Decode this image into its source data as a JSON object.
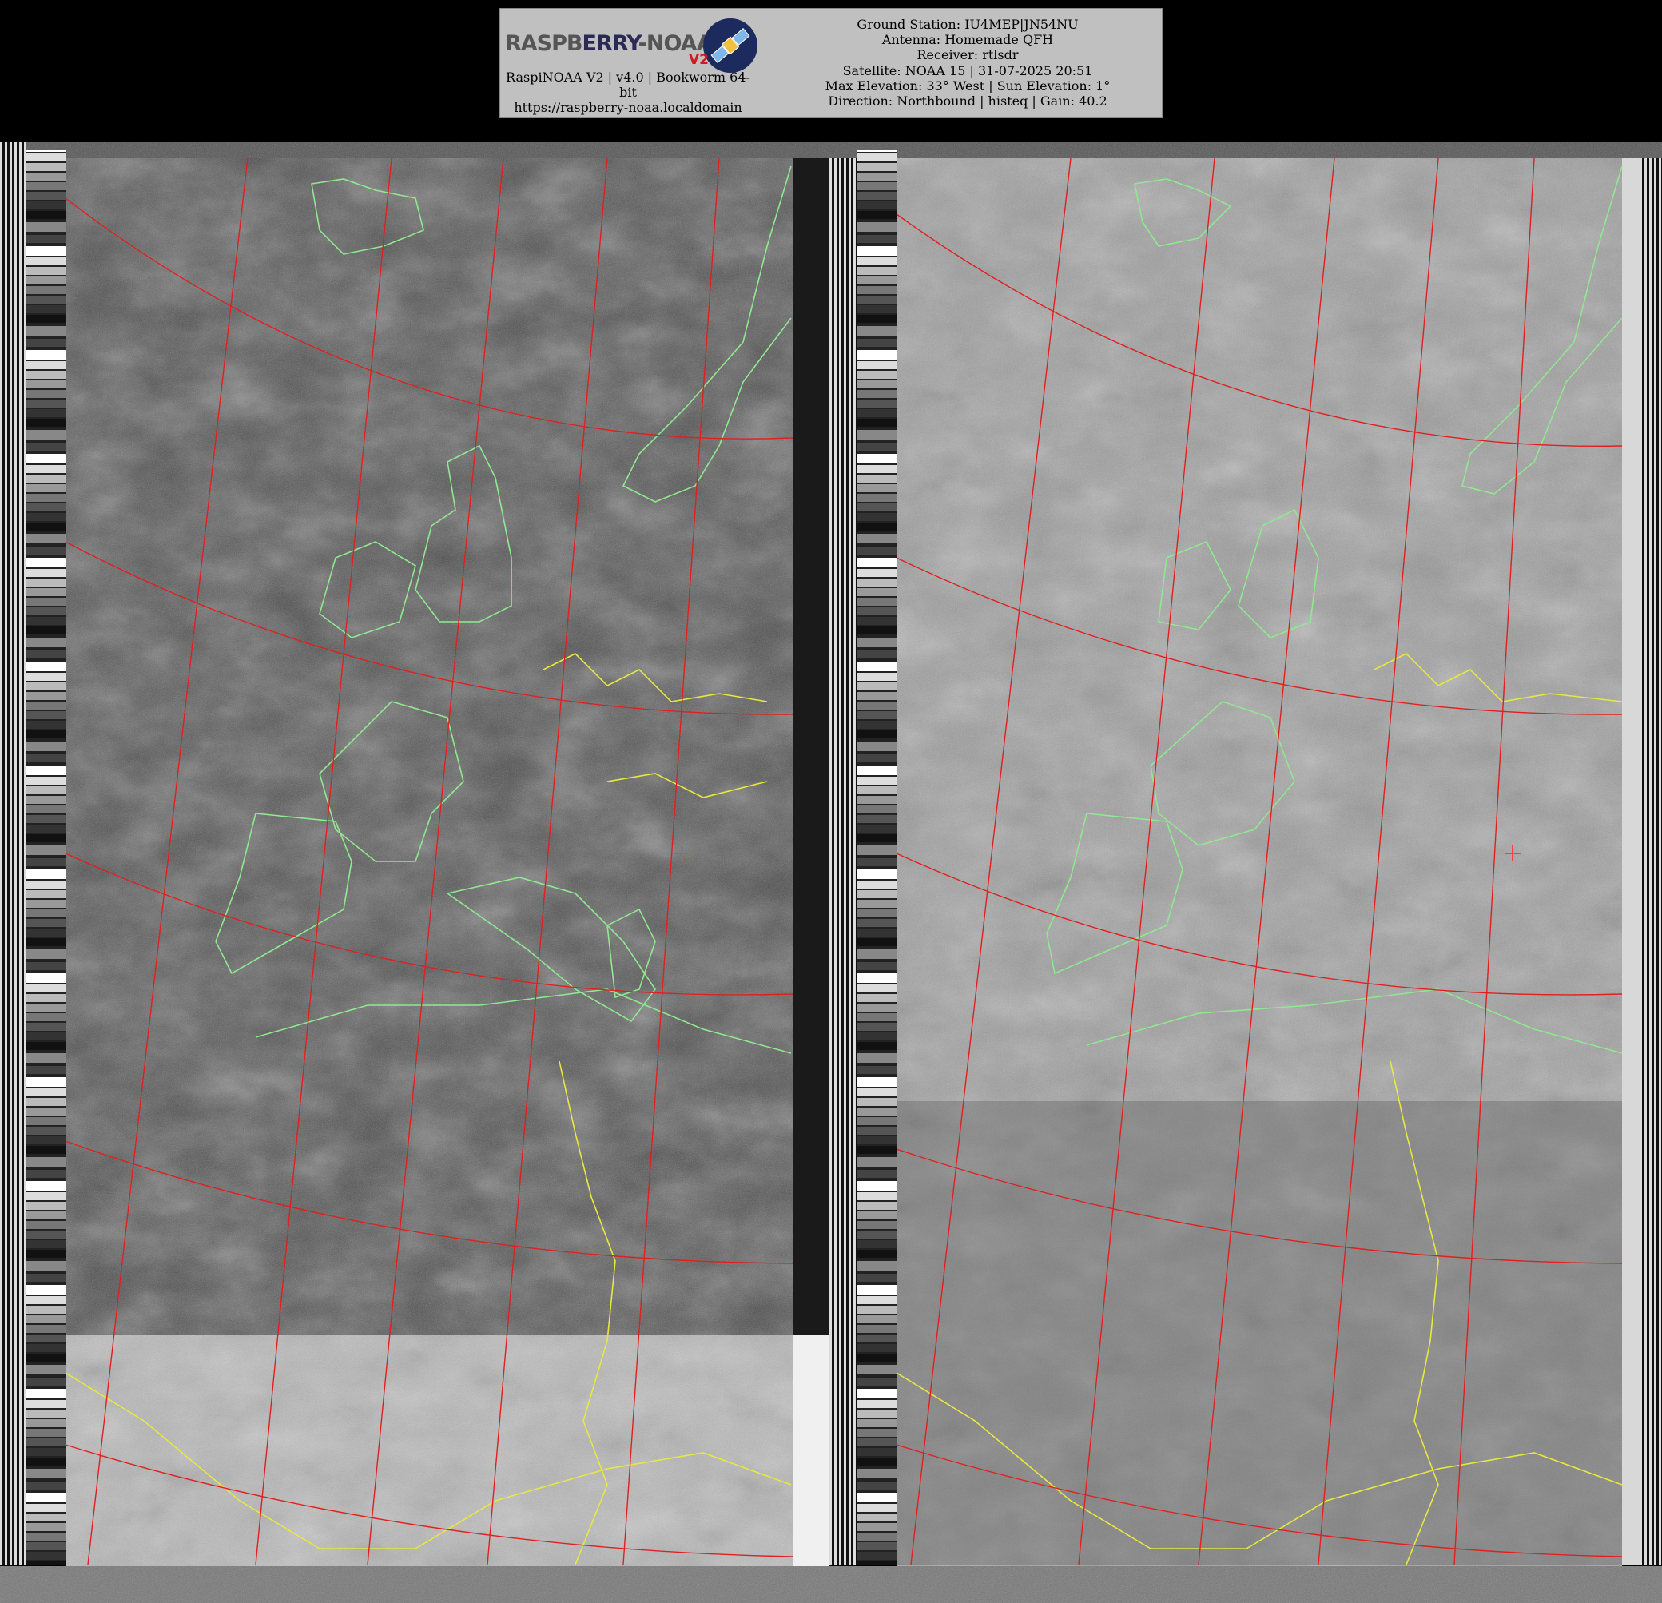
{
  "header": {
    "logo_text_a": "RASPB",
    "logo_text_b": "ERRY",
    "logo_text_c": "-NOAA",
    "logo_v2": "V2",
    "software": "RaspiNOAA V2 | v4.0 | Bookworm 64-",
    "software_cont": "bit",
    "url": "https://raspberry-noaa.localdomain",
    "ground_station": "Ground Station: IU4MEP|JN54NU",
    "antenna": "Antenna: Homemade QFH",
    "receiver": "Receiver: rtlsdr",
    "satellite": "Satellite: NOAA 15 | 31-07-2025 20:51",
    "elevation": "Max Elevation: 33° West | Sun Elevation: 1°",
    "direction": "Direction: Northbound | histeq | Gain: 40.2"
  },
  "colors": {
    "background": "#000000",
    "header_bg": "#c0c0c0",
    "coastline": "#90e890",
    "borders": "#e8e840",
    "grid": "#e02020",
    "station_marker": "#ff4040"
  },
  "panels": [
    {
      "name": "channel-a",
      "description_icon": "satellite-image-panel"
    },
    {
      "name": "channel-b",
      "description_icon": "satellite-image-panel"
    }
  ]
}
